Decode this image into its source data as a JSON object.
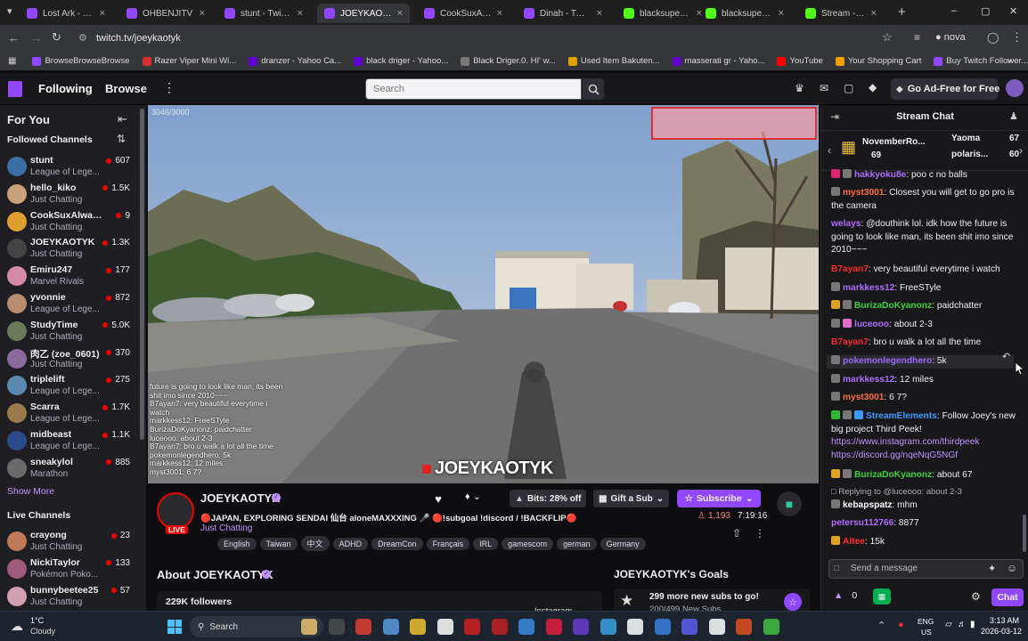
{
  "browser": {
    "tabs": [
      {
        "title": "Lost Ark - Twitch",
        "color": "#9146ff"
      },
      {
        "title": "OHBENJITV",
        "color": "#9146ff"
      },
      {
        "title": "stunt - Twitch",
        "color": "#9146ff"
      },
      {
        "title": "JOEYKAOTYK",
        "color": "#9146ff"
      },
      {
        "title": "CookSuxAlways",
        "color": "#9146ff"
      },
      {
        "title": "Dinah - Twitch",
        "color": "#9146ff"
      },
      {
        "title": "blacksupered St",
        "color": "#53fc18"
      },
      {
        "title": "blacksupered St",
        "color": "#53fc18"
      },
      {
        "title": "Stream - Kick D",
        "color": "#53fc18"
      }
    ],
    "url": "twitch.tv/joeykaotyk",
    "profile": "nova",
    "bookmarks": [
      {
        "label": "BrowseBrowseBrowse",
        "color": "#9146ff"
      },
      {
        "label": "Razer Viper Mini Wi...",
        "color": "#d32f2f"
      },
      {
        "label": "dranzer - Yahoo Ca...",
        "color": "#6001d2"
      },
      {
        "label": "black driger - Yahoo...",
        "color": "#6001d2"
      },
      {
        "label": "Black Driger.0. HI' w...",
        "color": "#777777"
      },
      {
        "label": "Used Item Bakuten...",
        "color": "#e0a000"
      },
      {
        "label": "masserati gr - Yaho...",
        "color": "#6001d2"
      },
      {
        "label": "YouTube",
        "color": "#ff0000"
      },
      {
        "label": "Your Shopping Cart",
        "color": "#f0a000"
      },
      {
        "label": "Buy Twitch Follower...",
        "color": "#9146ff"
      }
    ]
  },
  "nav": {
    "following": "Following",
    "browse": "Browse",
    "search_placeholder": "Search",
    "ad_free": "Go Ad-Free for Free"
  },
  "sidebar": {
    "for_you": "For You",
    "followed_title": "Followed Channels",
    "followed": [
      {
        "name": "stunt",
        "category": "League of Lege...",
        "viewers": "607",
        "color": "#3a6ea5"
      },
      {
        "name": "hello_kiko",
        "category": "Just Chatting",
        "viewers": "1.5K",
        "color": "#c9a27a"
      },
      {
        "name": "CookSuxAlway...",
        "category": "Just Chatting",
        "viewers": "9",
        "color": "#e0a030"
      },
      {
        "name": "JOEYKAOTYK",
        "category": "Just Chatting",
        "viewers": "1.3K",
        "color": "#444"
      },
      {
        "name": "Emiru247",
        "category": "Marvel Rivals",
        "viewers": "177",
        "color": "#d78aa8"
      },
      {
        "name": "yvonnie",
        "category": "League of Lege...",
        "viewers": "872",
        "color": "#b88c6e"
      },
      {
        "name": "StudyTime",
        "category": "Just Chatting",
        "viewers": "5.0K",
        "color": "#6a7a5a"
      },
      {
        "name": "肉乙 (zoe_0601)",
        "category": "Just Chatting",
        "viewers": "370",
        "color": "#8a6a9a"
      },
      {
        "name": "triplelift",
        "category": "League of Lege...",
        "viewers": "275",
        "color": "#5a8ab0"
      },
      {
        "name": "Scarra",
        "category": "League of Lege...",
        "viewers": "1.7K",
        "color": "#9a7a4a"
      },
      {
        "name": "midbeast",
        "category": "League of Lege...",
        "viewers": "1.1K",
        "color": "#2a4a8a"
      },
      {
        "name": "sneakylol",
        "category": "Marathon",
        "viewers": "885",
        "color": "#6a6a6a"
      }
    ],
    "show_more": "Show More",
    "live_title": "Live Channels",
    "live": [
      {
        "name": "crayong",
        "category": "Just Chatting",
        "viewers": "23",
        "color": "#c07a5a"
      },
      {
        "name": "NickiTaylor",
        "category": "Pokémon Poko...",
        "viewers": "133",
        "color": "#a05a7a"
      },
      {
        "name": "bunnybeetee25",
        "category": "Just Chatting",
        "viewers": "57",
        "color": "#d0a0b0"
      }
    ]
  },
  "video": {
    "watermark": "JOEYKAOTYK",
    "hud_counter": "3046/3000",
    "overlay_chat": [
      "future is going to look like man, its been",
      "shit imo since 2010~~~",
      "B7ayan7: very beautiful everytime i",
      "watch",
      "markkess12: FreeSTyle",
      "BurizaDoKyanonz: paidchatter",
      "luceooo: about 2-3",
      "B7ayan7: bro u walk a lot all the time",
      "pokemonlegendhero: 5k",
      "markkess12: 12 miles",
      "myst3001: 6 7?"
    ]
  },
  "stream": {
    "channel": "JOEYKAOTYK",
    "live": "LIVE",
    "title": "🔴JAPAN, EXPLORING SENDAI 仙台 aloneMAXXXING 🎤 🔴!subgoal !discord / !BACKFLIP🔴",
    "category": "Just Chatting",
    "tags": [
      "English",
      "Taiwan",
      "中文",
      "ADHD",
      "DreamCon",
      "Français",
      "IRL",
      "gamescom",
      "german",
      "Germany"
    ],
    "viewers": "1,193",
    "uptime": "7:19:16",
    "bits": "Bits: 28% off",
    "gift": "Gift a Sub",
    "subscribe": "Subscribe",
    "about": "About JOEYKAOTYK",
    "followers": "229K followers",
    "instagram": "Instagram",
    "goals_title": "JOEYKAOTYK's Goals",
    "goal_text": "299 more new subs to go!",
    "goal_progress": "200/499 New Subs"
  },
  "chat": {
    "title": "Stream Chat",
    "leaders": [
      {
        "name": "NovemberRo...",
        "count": "69"
      },
      {
        "name": "Yaoma",
        "count": "67"
      },
      {
        "name": "polaris...",
        "count": "60"
      }
    ],
    "messages": [
      {
        "user": "hakkyoku8e",
        "text": ": poo c no balls",
        "color": "#b06cff"
      },
      {
        "user": "myst3001",
        "text": ": Closest you will get to go pro is the camera",
        "color": "#ff6f3d"
      },
      {
        "user": "welays",
        "text": ": @douthink lol. idk how the future is going to look like man, its been shit imo since 2010~~~",
        "color": "#b06cff"
      },
      {
        "user": "B7ayan7",
        "text": ": very beautiful everytime i watch",
        "color": "#ff2a2a"
      },
      {
        "user": "markkess12",
        "text": ": FreeSTyle",
        "color": "#b06cff"
      },
      {
        "user": "BurizaDoKyanonz",
        "text": ": paidchatter",
        "color": "#3bd43b"
      },
      {
        "user": "luceooo",
        "text": ": about 2-3",
        "color": "#b06cff"
      },
      {
        "user": "B7ayan7",
        "text": ": bro u walk a lot all the time",
        "color": "#ff2a2a"
      },
      {
        "user": "pokemonlegendhero",
        "text": ": 5k",
        "color": "#9b6bff"
      },
      {
        "user": "markkess12",
        "text": ": 12 miles",
        "color": "#b06cff"
      },
      {
        "user": "myst3001",
        "text": ": 6 7?",
        "color": "#ff6f3d"
      },
      {
        "user": "StreamElements",
        "text": ": Follow Joey's new big project Third Peek!",
        "color": "#3c9bff"
      },
      {
        "user": "BurizaDoKyanonz",
        "text": ": about 67",
        "color": "#3bd43b"
      },
      {
        "user": "kebapspatz",
        "text": ": mhm",
        "color": "#ffffff"
      },
      {
        "user": "petersu112766",
        "text": ": 8877",
        "color": "#b06cff"
      },
      {
        "user": "Altee",
        "text": ": 15k",
        "color": "#ff2a2a"
      }
    ],
    "link1": "https://www.instagram.com/thirdpeek",
    "link2": "https://discord.gg/nqeNqG5NGf",
    "reply_label": "Replying to @luceooo: about 2-3",
    "input_placeholder": "Send a message",
    "points": "0",
    "chat_button": "Chat"
  },
  "taskbar": {
    "weather_temp": "1°C",
    "weather_text": "Cloudy",
    "search": "Search",
    "lang": "ENG",
    "region": "US",
    "time": "3:13 AM",
    "date": "2026-03-12"
  }
}
